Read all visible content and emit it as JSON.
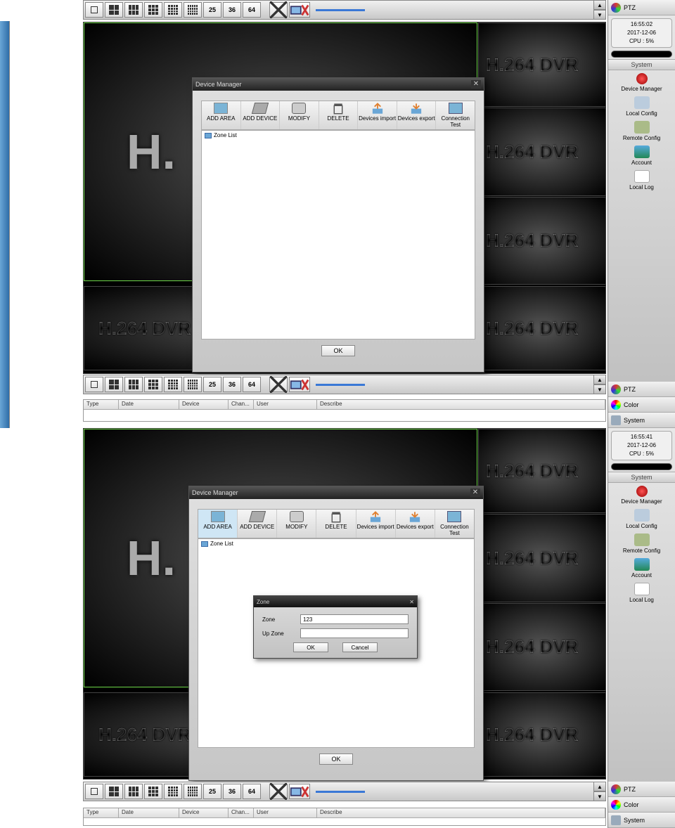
{
  "layout_numbers": [
    "25",
    "36",
    "64"
  ],
  "sidebar_tabs": {
    "ptz": "PTZ",
    "color": "Color",
    "system": "System"
  },
  "info1": {
    "time": "16:55:02",
    "date": "2017-12-06",
    "cpu": "CPU : 5%"
  },
  "info2": {
    "time": "16:55:41",
    "date": "2017-12-06",
    "cpu": "CPU : 5%"
  },
  "system_header": "System",
  "side_items": {
    "dev_mgr": "Device Manager",
    "local_cfg": "Local Config",
    "remote_cfg": "Remote Config",
    "account": "Account",
    "local_log": "Local Log"
  },
  "log_columns": {
    "type": "Type",
    "date": "Date",
    "device": "Device",
    "chan": "Chan...",
    "user": "User",
    "describe": "Describe"
  },
  "dvr_watermark": "H.264 DVR",
  "big_h": "H.",
  "device_manager": {
    "title": "Device Manager",
    "toolbar": {
      "add_area": "ADD AREA",
      "add_device": "ADD DEVICE",
      "modify": "MODIFY",
      "delete": "DELETE",
      "dev_import": "Devices import",
      "dev_export": "Devices export",
      "conn_test": "Connection Test"
    },
    "zone_list": "Zone List",
    "ok": "OK"
  },
  "zone_dialog": {
    "title": "Zone",
    "zone_label": "Zone",
    "upzone_label": "Up Zone",
    "zone_value": "123",
    "upzone_value": "",
    "ok": "OK",
    "cancel": "Cancel"
  }
}
